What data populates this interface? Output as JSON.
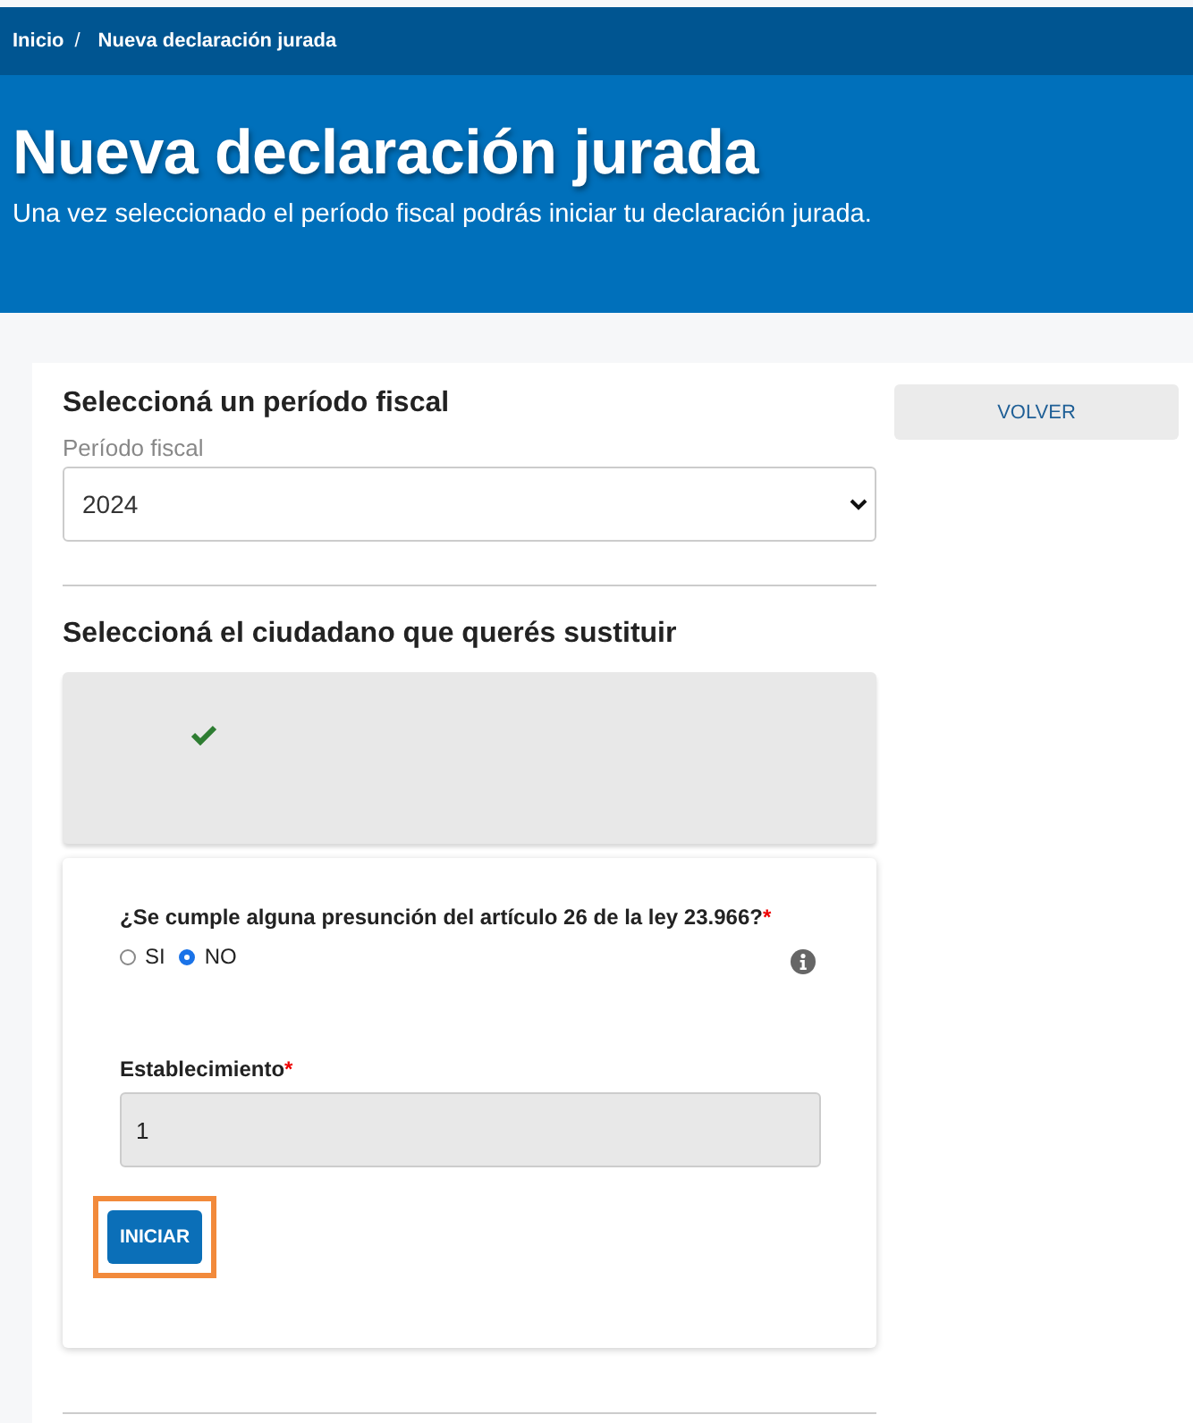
{
  "breadcrumb": [
    {
      "label": "Inicio",
      "separator": "/"
    },
    {
      "label": "Nueva declaración jurada"
    }
  ],
  "hero": {
    "title": "Nueva declaración jurada",
    "subtitle": "Una vez seleccionado el período fiscal podrás iniciar tu declaración jurada."
  },
  "period_section": {
    "heading": "Seleccioná un período fiscal",
    "field_label": "Período fiscal",
    "value": "2024"
  },
  "back_button": "VOLVER",
  "citizen_section": {
    "heading": "Seleccioná el ciudadano que querés sustituir",
    "selected": true
  },
  "form": {
    "question": {
      "label": "¿Se cumple alguna presunción del artículo 26 de la ley 23.966?",
      "required_mark": "*",
      "options": [
        {
          "label": "SI",
          "selected": false
        },
        {
          "label": "NO",
          "selected": true
        }
      ]
    },
    "establishment": {
      "label": "Establecimiento",
      "required_mark": "*",
      "value": "1"
    },
    "start_button": {
      "label": "INICIAR",
      "highlighted": true
    }
  }
}
